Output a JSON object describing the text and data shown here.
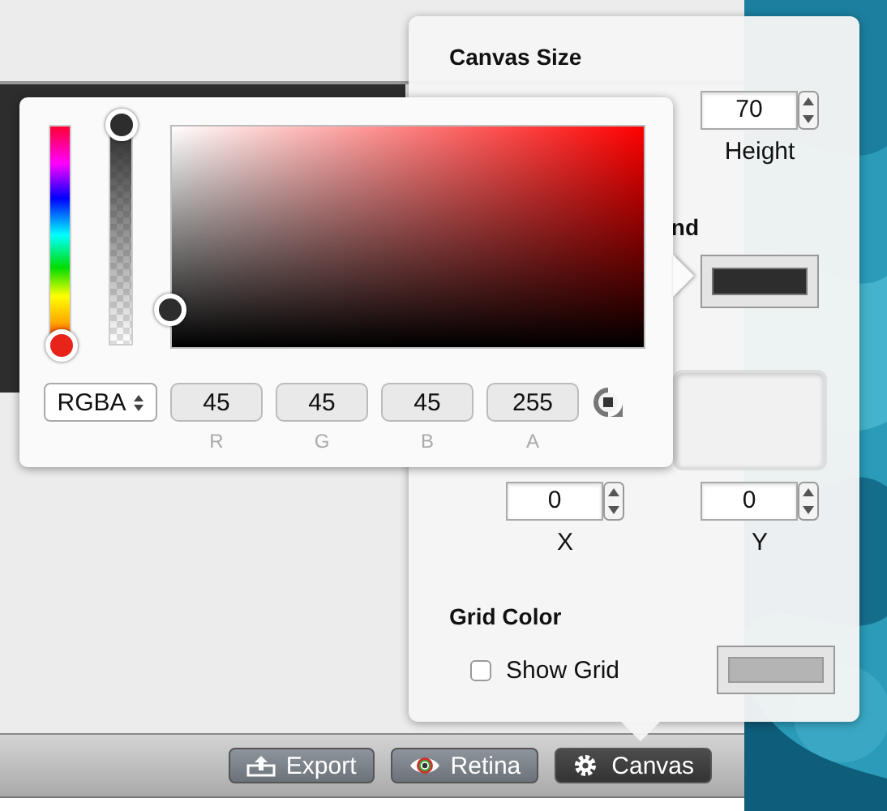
{
  "canvas_popover": {
    "canvas_size": {
      "title": "Canvas Size",
      "height_field": {
        "value": "70",
        "label": "Height"
      }
    },
    "background": {
      "title": "nd",
      "color": "#2d2d2d"
    },
    "offset": [
      {
        "value": "0",
        "label": "X"
      },
      {
        "value": "0",
        "label": "Y"
      }
    ],
    "grid": {
      "title": "Grid Color",
      "show_grid": {
        "label": "Show Grid",
        "checked": false
      },
      "color": "#b4b4b4"
    }
  },
  "color_picker": {
    "hue_slider": {
      "level": 0
    },
    "alpha_slider": {
      "level": 1
    },
    "mode": "RGBA",
    "channels": [
      {
        "value": "45",
        "label": "R"
      },
      {
        "value": "45",
        "label": "G"
      },
      {
        "value": "45",
        "label": "B"
      },
      {
        "value": "255",
        "label": "A"
      }
    ]
  },
  "toolbar": [
    {
      "kind": "export",
      "label": "Export",
      "selected": false
    },
    {
      "kind": "retina",
      "label": "Retina",
      "selected": false
    },
    {
      "kind": "canvas",
      "label": "Canvas",
      "selected": true
    }
  ]
}
